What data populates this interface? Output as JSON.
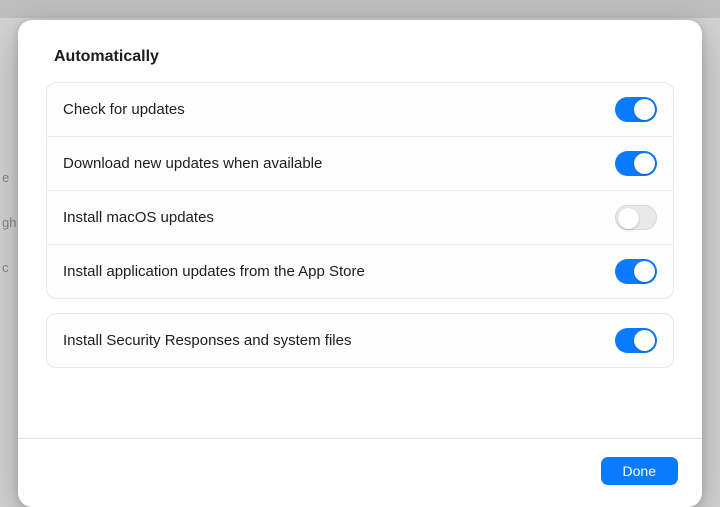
{
  "section_header": "Automatically",
  "groups": [
    {
      "rows": [
        {
          "label": "Check for updates",
          "on": true
        },
        {
          "label": "Download new updates when available",
          "on": true
        },
        {
          "label": "Install macOS updates",
          "on": false
        },
        {
          "label": "Install application updates from the App Store",
          "on": true
        }
      ]
    },
    {
      "rows": [
        {
          "label": "Install Security Responses and system files",
          "on": true
        }
      ]
    }
  ],
  "footer": {
    "done_label": "Done"
  },
  "colors": {
    "accent": "#0a7aff",
    "toggle_off": "#e9e9ea"
  }
}
